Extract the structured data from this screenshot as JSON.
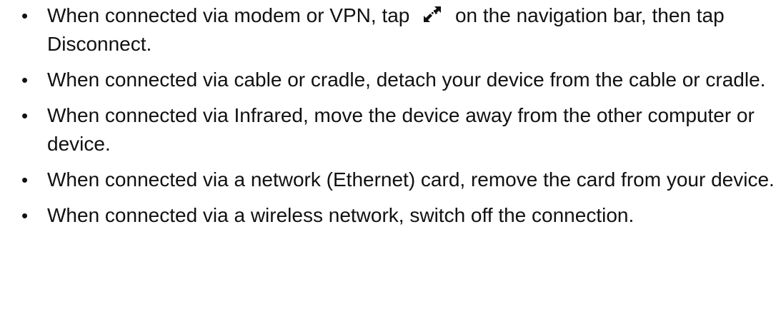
{
  "bullet_char": "•",
  "items": [
    {
      "before_icon": "When connected via modem or VPN, tap",
      "icon": "connection-icon",
      "after_icon": "on the navigation bar, then tap Disconnect."
    },
    {
      "text": "When connected via cable or cradle, detach your device from the cable or cradle."
    },
    {
      "text": "When connected via Infrared, move the device away from the other computer or device."
    },
    {
      "text": "When connected via a network (Ethernet) card, remove the card from your device."
    },
    {
      "text": "When connected via a wireless network, switch off the connection."
    }
  ]
}
